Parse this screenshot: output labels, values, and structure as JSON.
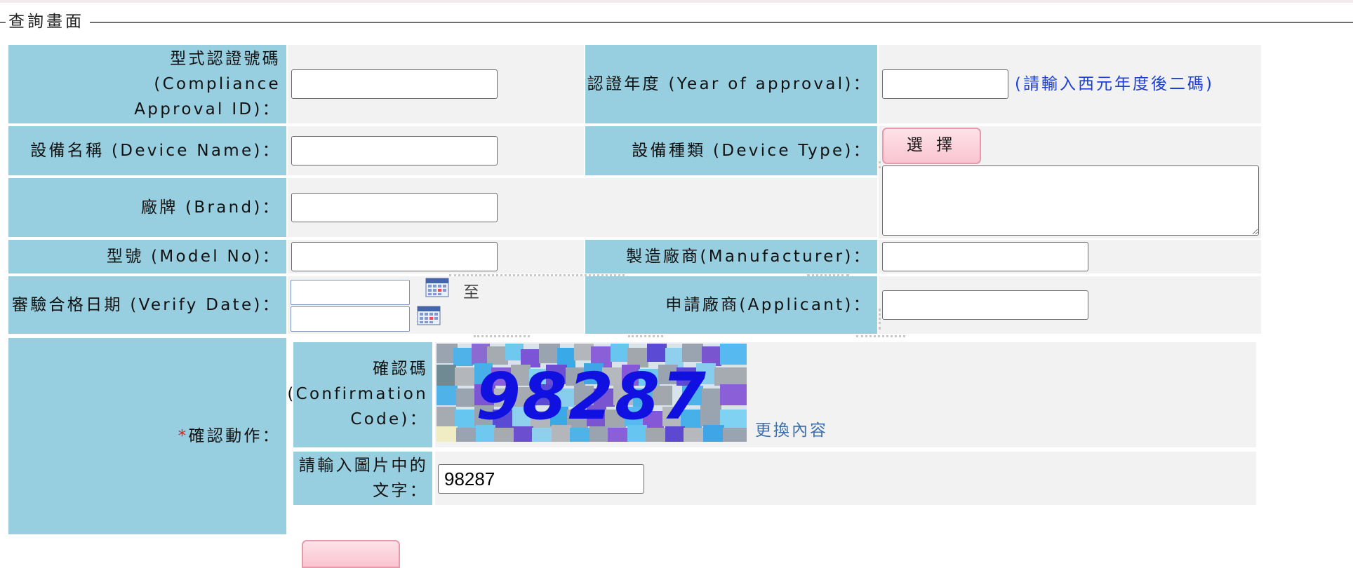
{
  "fieldset": {
    "legend": "查詢畫面"
  },
  "fields": {
    "compliance_id_label": [
      "型式認證號碼",
      "(Compliance",
      "Approval ID)："
    ],
    "year_label": "認證年度 (Year of approval)：",
    "year_hint": "(請輸入西元年度後二碼)",
    "device_name_label": "設備名稱 (Device Name)：",
    "device_type_label": "設備種類 (Device Type)：",
    "device_type_button": "選 擇",
    "brand_label": "廠牌 (Brand)：",
    "model_label": "型號 (Model No)：",
    "manufacturer_label": "製造廠商(Manufacturer)：",
    "verify_date_label": "審驗合格日期 (Verify Date)：",
    "date_to": "至",
    "applicant_label": "申請廠商(Applicant)："
  },
  "captcha": {
    "required_mark": "*",
    "action_label": "確認動作：",
    "code_label": [
      "確認碼",
      "(Confirmation",
      "Code)："
    ],
    "code_image_text": "98287",
    "refresh_link": "更換內容",
    "input_label": [
      "請輸入圖片中的",
      "文字："
    ],
    "input_value": "98287"
  },
  "colors": {
    "label_bg": "#98cfe0",
    "value_bg": "#f2f2f2",
    "hint": "#1d3fd6",
    "button": "#f9c4d0"
  }
}
